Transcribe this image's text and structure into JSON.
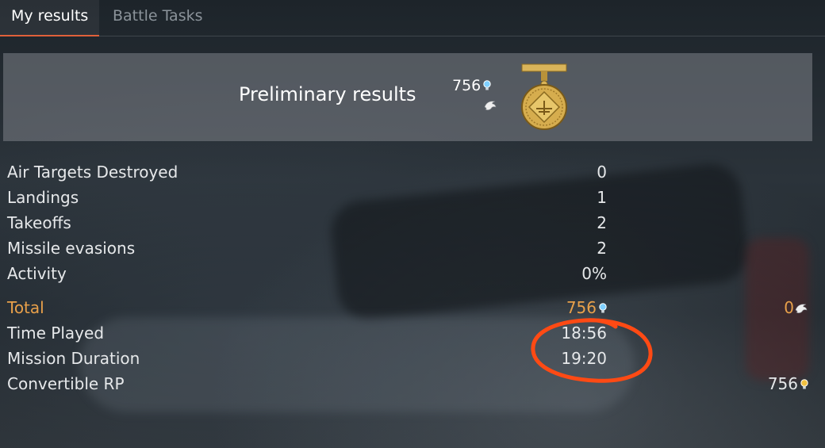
{
  "tabs": [
    {
      "label": "My results",
      "active": true
    },
    {
      "label": "Battle Tasks",
      "active": false
    }
  ],
  "banner": {
    "title": "Preliminary results",
    "rp": "756",
    "rp_icon": "research-bulb-icon",
    "sl_icon": "eagle-icon",
    "medal_icon": "medal-icon"
  },
  "stats": [
    {
      "label": "Air Targets Destroyed",
      "value": "0"
    },
    {
      "label": "Landings",
      "value": "1"
    },
    {
      "label": "Takeoffs",
      "value": "2"
    },
    {
      "label": "Missile evasions",
      "value": "2"
    },
    {
      "label": "Activity",
      "value": "0%"
    }
  ],
  "total": {
    "label": "Total",
    "rp": "756",
    "sl": "0"
  },
  "time": [
    {
      "label": "Time Played",
      "value": "18:56"
    },
    {
      "label": "Mission Duration",
      "value": "19:20"
    }
  ],
  "convertible": {
    "label": "Convertible RP",
    "value": "756"
  },
  "colors": {
    "accent": "#e0603a",
    "total": "#e8a04a",
    "annotation": "#ff4a14",
    "rp_blue": "#7fd0ff",
    "rp_gold": "#f0c040"
  }
}
